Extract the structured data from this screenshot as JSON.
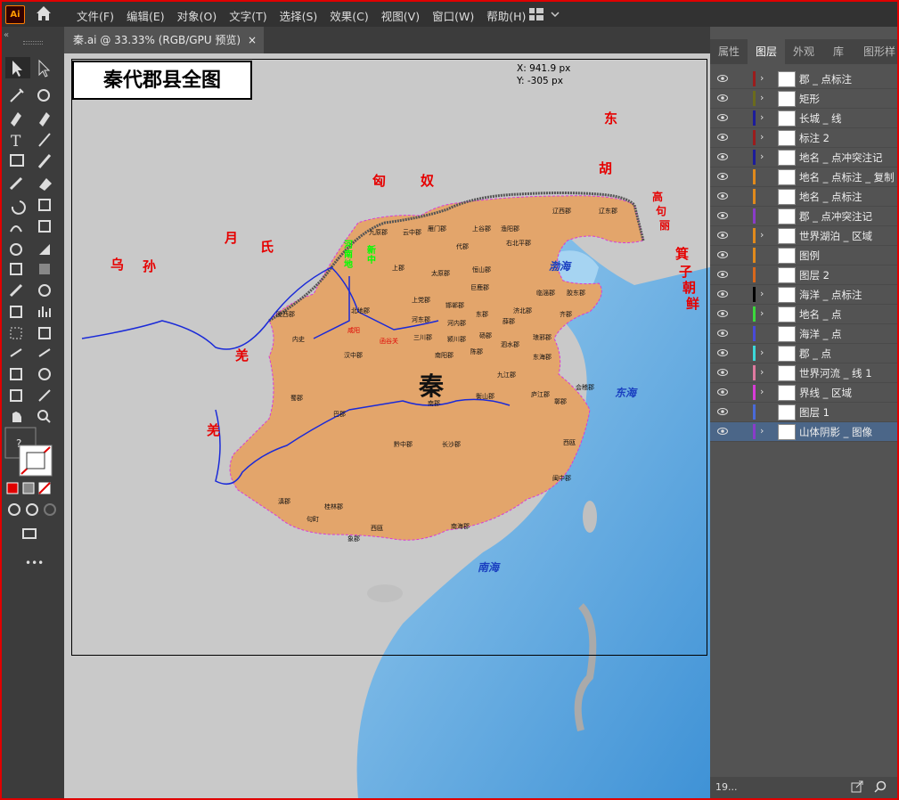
{
  "app": {
    "logo_text": "Ai",
    "menus": [
      "文件(F)",
      "编辑(E)",
      "对象(O)",
      "文字(T)",
      "选择(S)",
      "效果(C)",
      "视图(V)",
      "窗口(W)",
      "帮助(H)"
    ]
  },
  "document": {
    "tab_title": "秦.ai @ 33.33% (RGB/GPU 预览)",
    "tab_close": "×",
    "map_title": "秦代郡县全图",
    "cursor_x": "X: 941.9 px",
    "cursor_y": "Y: -305 px"
  },
  "map": {
    "state_label": "秦",
    "regions": [
      "东",
      "胡",
      "匈",
      "奴",
      "月",
      "氏",
      "乌",
      "孙",
      "羌",
      "羌",
      "高",
      "句",
      "丽",
      "箕",
      "子",
      "朝",
      "鲜"
    ],
    "seas": [
      "渤海",
      "东海",
      "南海"
    ],
    "commanderies": [
      "辽西郡",
      "辽东郡",
      "右北平郡",
      "渔阳郡",
      "上谷郡",
      "代郡",
      "雁门郡",
      "云中郡",
      "九原郡",
      "太原郡",
      "上郡",
      "恒山郡",
      "巨鹿郡",
      "邯郸郡",
      "上党郡",
      "河东郡",
      "河内郡",
      "东郡",
      "济北郡",
      "齐郡",
      "琅邪郡",
      "胶东郡",
      "临淄郡",
      "薛郡",
      "三川郡",
      "颍川郡",
      "砀郡",
      "泗水郡",
      "东海郡",
      "陈郡",
      "南阳郡",
      "九江郡",
      "会稽郡",
      "鄣郡",
      "庐江郡",
      "衡山郡",
      "南郡",
      "长沙郡",
      "黔中郡",
      "巴郡",
      "蜀郡",
      "汉中郡",
      "陇西郡",
      "北地郡",
      "内史",
      "闽中郡",
      "南海郡",
      "桂林郡",
      "象郡",
      "西瓯",
      "句町",
      "滇郡",
      "西瓯"
    ],
    "misc_labels": [
      "咸阳",
      "函谷关",
      "河南地",
      "新中"
    ]
  },
  "layers_panel": {
    "tabs": [
      "属性",
      "图层",
      "外观",
      "库",
      "图形样"
    ],
    "active_tab": "图层",
    "layers": [
      {
        "name": "郡 _ 点标注",
        "color": "#9b1c1c",
        "expand": "›"
      },
      {
        "name": "矩形",
        "color": "#6b6b1c",
        "expand": "›"
      },
      {
        "name": "长城 _ 线",
        "color": "#1c1c9b",
        "expand": "›"
      },
      {
        "name": "标注 2",
        "color": "#9b1c1c",
        "expand": "›"
      },
      {
        "name": "地名 _ 点冲突注记",
        "color": "#1c1c9b",
        "expand": "›"
      },
      {
        "name": "地名 _ 点标注 _ 复制",
        "color": "#e08a1c",
        "expand": ""
      },
      {
        "name": "地名 _ 点标注",
        "color": "#e08a1c",
        "expand": ""
      },
      {
        "name": "郡 _ 点冲突注记",
        "color": "#8a3cc8",
        "expand": ""
      },
      {
        "name": "世界湖泊 _ 区域",
        "color": "#e08a1c",
        "expand": "›"
      },
      {
        "name": "图例",
        "color": "#e08a1c",
        "expand": ""
      },
      {
        "name": "图层 2",
        "color": "#d8681c",
        "expand": ""
      },
      {
        "name": "海洋 _ 点标注",
        "color": "#000000",
        "expand": "›"
      },
      {
        "name": "地名 _ 点",
        "color": "#3cd83c",
        "expand": "›"
      },
      {
        "name": "海洋 _ 点",
        "color": "#4a4ad8",
        "expand": ""
      },
      {
        "name": "郡 _ 点",
        "color": "#3cd8d8",
        "expand": "›"
      },
      {
        "name": "世界河流 _ 线 1",
        "color": "#e07aa0",
        "expand": "›"
      },
      {
        "name": "界线 _ 区域",
        "color": "#d83cd8",
        "expand": "›"
      },
      {
        "name": "图层 1",
        "color": "#4a6ad8",
        "expand": ""
      },
      {
        "name": "山体阴影 _ 图像",
        "color": "#8a3cc8",
        "expand": "›"
      }
    ],
    "footer_count": "19..."
  }
}
